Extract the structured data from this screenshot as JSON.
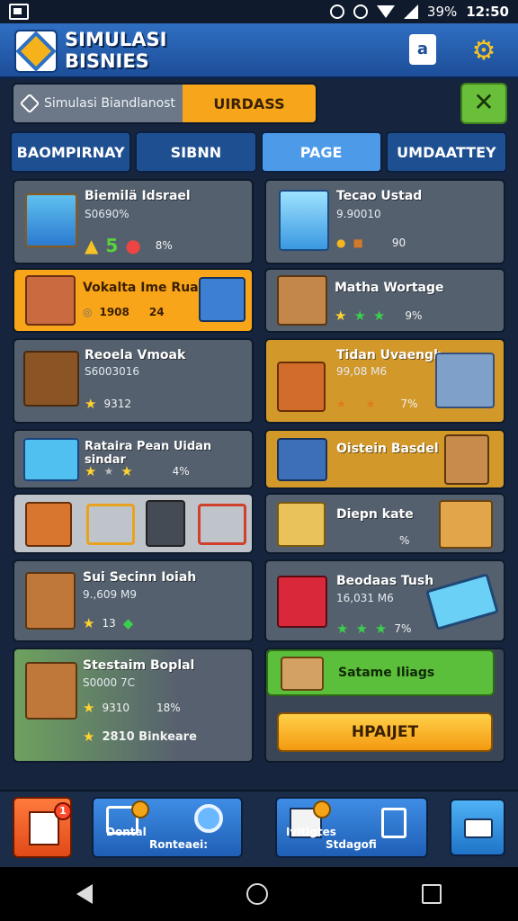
{
  "statusbar": {
    "battery": "39%",
    "time": "12:50"
  },
  "header": {
    "title_line1": "SIMULASI",
    "title_line2": "BISNIES",
    "bag_label": "a"
  },
  "search": {
    "placeholder": "Simulasi Biandlanost",
    "action": "UIRDASS"
  },
  "tabs": [
    {
      "label": "BAOMPIRNAY"
    },
    {
      "label": "SIBNN"
    },
    {
      "label": "PAGE"
    },
    {
      "label": "UMDAATTEY"
    }
  ],
  "cards": {
    "c1": {
      "name": "Biemilä Idsrael",
      "sub": "S0690%",
      "meta": "5",
      "pct": "8%"
    },
    "c2": {
      "name": "Tecao Ustad",
      "sub": "9.90010",
      "pct": "90"
    },
    "c3": {
      "name": "Vokalta Ime Ruan",
      "meta": "1908",
      "meta2": "24"
    },
    "c4": {
      "name": "Matha Wortage",
      "pct": "9%"
    },
    "c5": {
      "name": "Reoela Vmoak",
      "sub": "S6003016",
      "meta": "9312"
    },
    "c6": {
      "name": "Tidan Uvaengh",
      "sub": "99,08 M6",
      "pct": "7%"
    },
    "c7": {
      "name": "Rataira Pean Uidan sindar",
      "pct": "4%"
    },
    "c8": {
      "name": "Oistein Basdel"
    },
    "c9": {
      "name": ""
    },
    "c10": {
      "name": "Diepn kate",
      "pct": "%"
    },
    "c11": {
      "name": "Sui Secinn Ioiah",
      "sub": "9.,609 M9",
      "meta": "13"
    },
    "c12": {
      "name": "Beodaas Tush",
      "sub": "16,031 M6",
      "pct": "7%"
    },
    "c13": {
      "name": "Stestaim Boplal",
      "sub": "S0000 7C",
      "meta": "9310",
      "pct": "18%",
      "extra": "2810 Binkeare"
    },
    "c14": {
      "name": "Satame Iliags"
    },
    "c15": {
      "name": "HPAIJET"
    }
  },
  "bottomnav": {
    "b1": "Dontal",
    "b2": "Ronteaei:",
    "b3": "Ivitigtes",
    "b4": "Stdagofi",
    "badge": "1"
  },
  "colors": {
    "accent": "#f8a519",
    "primary": "#2f6fc2",
    "success": "#6abf3a"
  }
}
